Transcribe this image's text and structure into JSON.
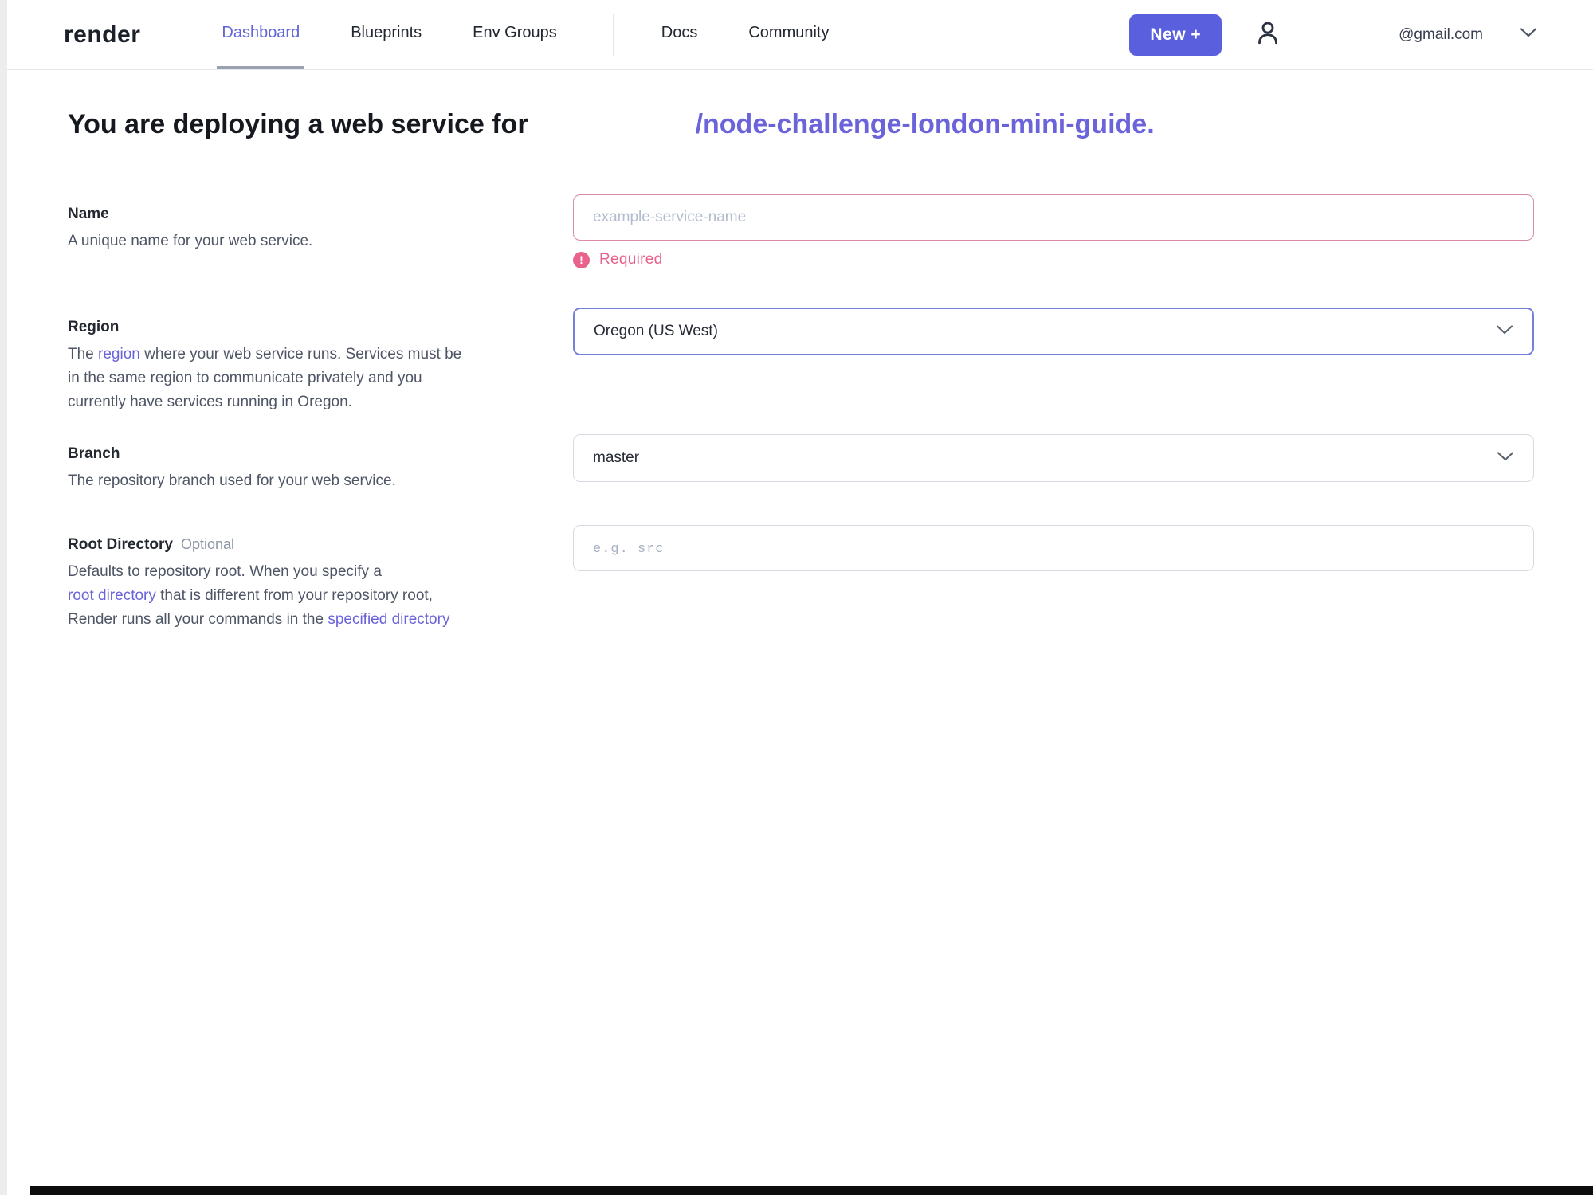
{
  "colors": {
    "accent_purple": "#6a63d9",
    "active_nav": "#6165d7",
    "new_button_bg": "#5a5fdd",
    "error_pink": "#e8628c",
    "error_border": "#d98ca4",
    "focus_border": "#7381d9"
  },
  "icons": {
    "user": "user-icon",
    "chevron_down": "chevron-down-icon",
    "error": "exclamation-circle-icon"
  },
  "nav": {
    "logo": "render",
    "items": [
      {
        "label": "Dashboard",
        "active": true
      },
      {
        "label": "Blueprints",
        "active": false
      },
      {
        "label": "Env Groups",
        "active": false
      },
      {
        "label": "Docs",
        "active": false
      },
      {
        "label": "Community",
        "active": false
      }
    ],
    "new_button_label": "New +",
    "email": "@gmail.com"
  },
  "heading": {
    "prefix": "You are deploying a web service for",
    "repo_link": "/node-challenge-london-mini-guide."
  },
  "form": {
    "name": {
      "label": "Name",
      "description": "A unique name for your web service.",
      "placeholder": "example-service-name",
      "value": "",
      "error": "Required",
      "error_icon": "!"
    },
    "region": {
      "label": "Region",
      "desc_line1_pre": "The ",
      "desc_line1_link": "region",
      "desc_line1_rest": " where your web service runs. Services must be",
      "desc_line2": "in the same region to communicate privately and you",
      "desc_line3": "currently have services running in Oregon.",
      "value": "Oregon (US West)"
    },
    "branch": {
      "label": "Branch",
      "description": "The repository branch used for your web service.",
      "value": "master"
    },
    "root_directory": {
      "label": "Root Directory",
      "optional_tag": "Optional",
      "desc_line1": "Defaults to repository root. When you specify a",
      "desc_line2_link": "root directory",
      "desc_line2_rest": " that is different from your repository root,",
      "desc_line3_pre": "Render runs all your commands in the ",
      "desc_line3_link": "specified directory",
      "placeholder": "e.g. src",
      "value": ""
    }
  }
}
